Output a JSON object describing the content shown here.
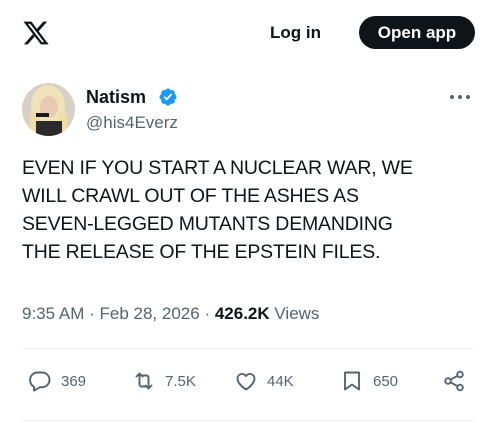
{
  "header": {
    "logo_icon": "x-logo-icon",
    "login_label": "Log in",
    "open_app_label": "Open app"
  },
  "author": {
    "name": "Natism",
    "handle": "@his4Everz",
    "verified_icon": "verified-badge-icon",
    "verified_color": "#1d9bf0"
  },
  "post": {
    "lines": [
      "EVEN IF YOU START A NUCLEAR WAR, WE",
      "WILL CRAWL OUT OF THE ASHES AS",
      "SEVEN-LEGGED MUTANTS DEMANDING",
      "THE RELEASE OF THE EPSTEIN FILES."
    ],
    "time": "9:35 AM",
    "date": "Feb 28, 2026",
    "views_count": "426.2K",
    "views_label": "Views"
  },
  "actions": {
    "replies": "369",
    "reposts": "7.5K",
    "likes": "44K",
    "bookmarks": "650",
    "icons": [
      "reply-icon",
      "repost-icon",
      "like-icon",
      "bookmark-icon",
      "share-icon"
    ]
  }
}
